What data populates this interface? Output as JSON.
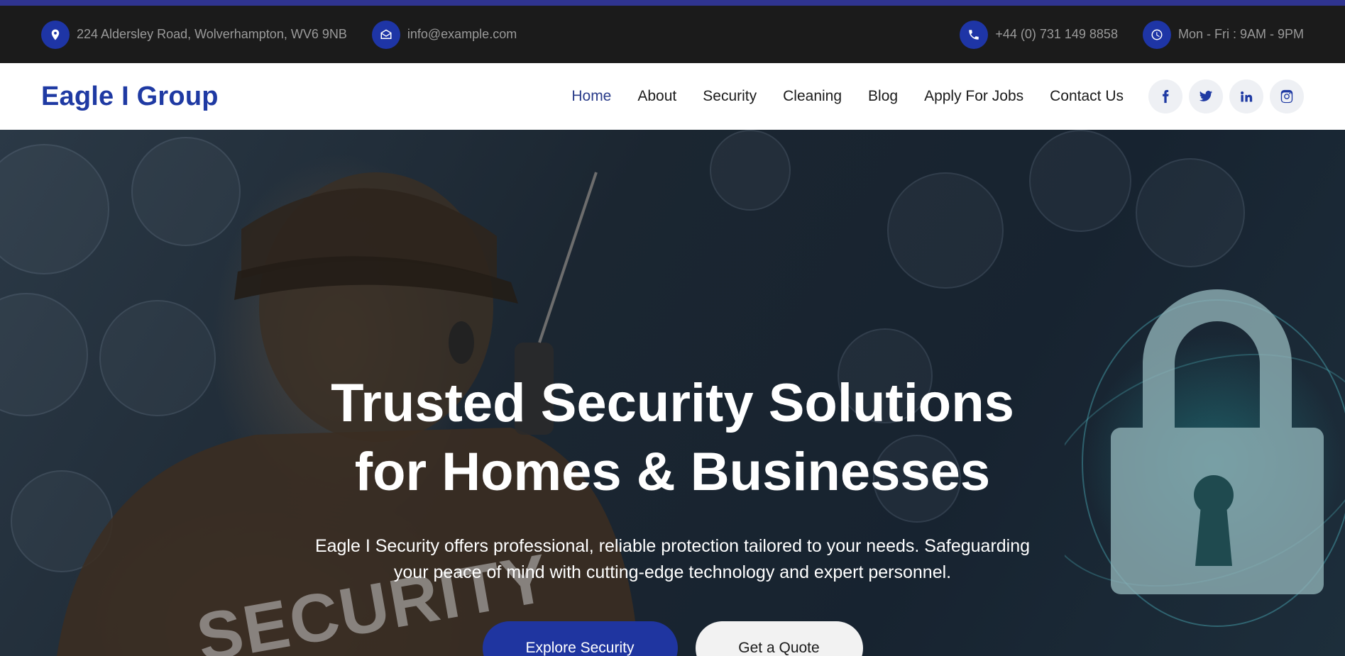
{
  "topbar": {
    "address": "224 Aldersley Road, Wolverhampton, WV6 9NB",
    "email": "info@example.com",
    "phone": "+44 (0) 731 149 8858",
    "hours": "Mon - Fri : 9AM - 9PM",
    "icons": [
      "location-pin-icon",
      "envelope-icon",
      "phone-icon",
      "clock-icon"
    ]
  },
  "navbar": {
    "brand": "Eagle I Group",
    "links": [
      {
        "label": "Home",
        "active": true
      },
      {
        "label": "About"
      },
      {
        "label": "Security"
      },
      {
        "label": "Cleaning"
      },
      {
        "label": "Blog"
      },
      {
        "label": "Apply For Jobs"
      },
      {
        "label": "Contact Us"
      }
    ],
    "socials": [
      "facebook-icon",
      "twitter-icon",
      "linkedin-icon",
      "instagram-icon"
    ]
  },
  "hero": {
    "title_line1": "Trusted Security Solutions",
    "title_line2": "for Homes & Businesses",
    "subtitle_line1": "Eagle I Security offers professional, reliable protection tailored to your needs. Safeguarding",
    "subtitle_line2": "your peace of mind with cutting-edge technology and expert personnel.",
    "image_text": "SECURITY",
    "buttons": {
      "primary": "Explore Security",
      "secondary": "Get a Quote"
    }
  },
  "colors": {
    "accent": "#1f3aa3",
    "topbar_bg": "#1b1b1b",
    "top_strip": "#2f3490"
  }
}
